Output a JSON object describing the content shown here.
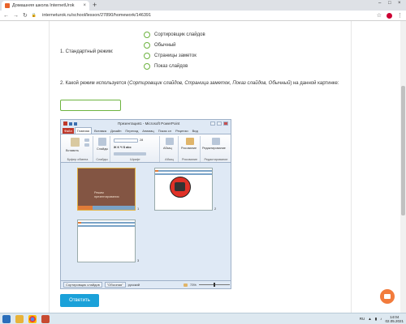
{
  "browser": {
    "tab_title": "Домашняя школа InternetUrok",
    "tab_close": "×",
    "new_tab": "+",
    "window_controls": [
      "–",
      "□",
      "×"
    ],
    "url": "interneturok.ru/school/lesson/27890/homework/146391"
  },
  "question1": {
    "label": "1. Стандартный режим:",
    "options": [
      "Сортировщик слайдов",
      "Обычный",
      "Страницы заметок",
      "Показ слайдов"
    ]
  },
  "question2": {
    "text_before": "2. Какой режим используется (",
    "options_italic": "Сортировщик слайдов, Страница заметок, Показ слайдов, Обычный",
    "text_after": ") на данной картинке:",
    "answer_value": ""
  },
  "ppt": {
    "caption": "Презентация1 - Microsoft PowerPoint",
    "ribbon_tabs": [
      "Файл",
      "Главная",
      "Вставка",
      "Дизайн",
      "Переход",
      "Анимац",
      "Показ сл",
      "Рецензи",
      "Вид"
    ],
    "ribbon_groups": [
      "Буфер обмена",
      "Слайды",
      "Шрифт",
      "Абзац",
      "Рисование",
      "Редактирование"
    ],
    "buttons": {
      "paste": "Вставить",
      "slides": "Слайды",
      "paragraph": "Абзац",
      "drawing": "Рисование",
      "editing": "Редактирование",
      "font_size": "28"
    },
    "slide1_text": "Режим\nпрезентирования",
    "slide_numbers": [
      "1",
      "2",
      "3"
    ],
    "status_view": "Сортировщик слайдов",
    "status_theme": "\"Обычная\"",
    "status_lang": "русский",
    "zoom": "73%"
  },
  "submit_label": "Ответить",
  "taskbar": {
    "lang": "RU",
    "time": "14:04",
    "date": "02.05.2021"
  },
  "colors": {
    "radio_border": "#6db33f",
    "submit_bg": "#1aa1d9",
    "chat_bg": "#f27b3c"
  }
}
